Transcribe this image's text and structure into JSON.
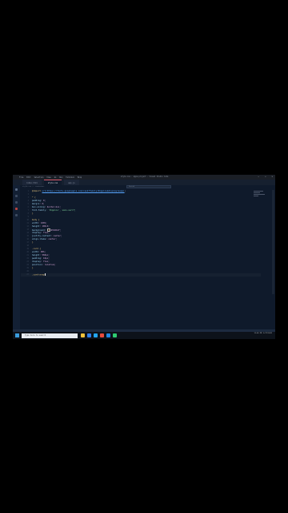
{
  "window": {
    "title": "style.css - apps-project - Visual Studio Code",
    "menu": [
      "File",
      "Edit",
      "Selection",
      "View",
      "Go",
      "Run",
      "Terminal",
      "Help"
    ],
    "controls": [
      "—",
      "☐",
      "✕"
    ]
  },
  "tabs": [
    {
      "label": "index.html"
    },
    {
      "label": "style.css",
      "active": true
    },
    {
      "label": "app.js"
    }
  ],
  "breadcrumb": "style.css > .container",
  "find": {
    "placeholder": "Search"
  },
  "code_lines": [
    {
      "n": "1",
      "tokens": [
        {
          "t": "@import ",
          "c": "sel"
        },
        {
          "t": "url(https://fonts.googleapis.com/css2?family=Poppins&display=swap)",
          "c": "url"
        },
        {
          "t": ";",
          "c": ""
        }
      ]
    },
    {
      "n": "2",
      "tokens": []
    },
    {
      "n": "3",
      "tokens": [
        {
          "t": "* {",
          "c": "brace"
        }
      ]
    },
    {
      "n": "4",
      "tokens": [
        {
          "t": "  padding",
          "c": "prop"
        },
        {
          "t": ": 0;",
          "c": "val"
        }
      ]
    },
    {
      "n": "5",
      "tokens": [
        {
          "t": "  margin",
          "c": "prop"
        },
        {
          "t": ": 0;",
          "c": "val"
        }
      ]
    },
    {
      "n": "6",
      "tokens": [
        {
          "t": "  box-sizing",
          "c": "prop"
        },
        {
          "t": ": border-box;",
          "c": "val"
        }
      ]
    },
    {
      "n": "7",
      "tokens": [
        {
          "t": "  font-family",
          "c": "prop"
        },
        {
          "t": ": 'Poppins', sans-serif;",
          "c": "str"
        }
      ]
    },
    {
      "n": "8",
      "tokens": [
        {
          "t": "}",
          "c": "brace"
        }
      ]
    },
    {
      "n": "9",
      "tokens": []
    },
    {
      "n": "10",
      "tokens": [
        {
          "t": "body {",
          "c": "brace"
        }
      ]
    },
    {
      "n": "11",
      "tokens": [
        {
          "t": "  width",
          "c": "prop"
        },
        {
          "t": ": 100%;",
          "c": "val"
        }
      ]
    },
    {
      "n": "12",
      "tokens": [
        {
          "t": "  height",
          "c": "prop"
        },
        {
          "t": ": 100vh;",
          "c": "val"
        }
      ]
    },
    {
      "n": "13",
      "tokens": [
        {
          "t": "  background",
          "c": "prop"
        },
        {
          "t": ": ",
          "c": ""
        },
        {
          "t": "#3d2b1f;",
          "c": "val",
          "swatch": true
        }
      ]
    },
    {
      "n": "14",
      "tokens": [
        {
          "t": "  display",
          "c": "prop"
        },
        {
          "t": ": flex;",
          "c": "val"
        }
      ]
    },
    {
      "n": "15",
      "tokens": [
        {
          "t": "  justify-content",
          "c": "prop"
        },
        {
          "t": ": center;",
          "c": "val"
        }
      ]
    },
    {
      "n": "16",
      "tokens": [
        {
          "t": "  align-items",
          "c": "prop"
        },
        {
          "t": ": center;",
          "c": "val"
        }
      ]
    },
    {
      "n": "17",
      "tokens": [
        {
          "t": "}",
          "c": "brace"
        }
      ]
    },
    {
      "n": "18",
      "tokens": []
    },
    {
      "n": "19",
      "tokens": [
        {
          "t": ".card {",
          "c": "brace"
        }
      ]
    },
    {
      "n": "20",
      "tokens": [
        {
          "t": "  width",
          "c": "prop"
        },
        {
          "t": ": 90%;",
          "c": "val"
        }
      ]
    },
    {
      "n": "21",
      "tokens": [
        {
          "t": "  height",
          "c": "prop"
        },
        {
          "t": ": 560px;",
          "c": "val"
        }
      ]
    },
    {
      "n": "22",
      "tokens": [
        {
          "t": "  padding",
          "c": "prop"
        },
        {
          "t": ": 10px;",
          "c": "val"
        }
      ]
    },
    {
      "n": "23",
      "tokens": [
        {
          "t": "  display",
          "c": "prop"
        },
        {
          "t": ": flex;",
          "c": "val"
        }
      ]
    },
    {
      "n": "24",
      "tokens": [
        {
          "t": "  position",
          "c": "prop"
        },
        {
          "t": ": relative;",
          "c": "val"
        }
      ]
    },
    {
      "n": "25",
      "tokens": [
        {
          "t": "}",
          "c": "brace"
        }
      ]
    },
    {
      "n": "26",
      "tokens": []
    },
    {
      "n": "27",
      "tokens": [
        {
          "t": ".card-wrap",
          "c": "sel"
        }
      ],
      "cursor": true
    }
  ],
  "taskbar": {
    "search": "Type here to search",
    "time": "12:45 PM",
    "date": "5/27/2022",
    "app_colors": [
      "#f2c23a",
      "#2f80ed",
      "#22a6f2",
      "#e94c3d",
      "#1e88e5",
      "#2ecc71"
    ]
  },
  "colors": {
    "accent": "#d95b6b",
    "editor_bg": "#0f1a2b"
  }
}
